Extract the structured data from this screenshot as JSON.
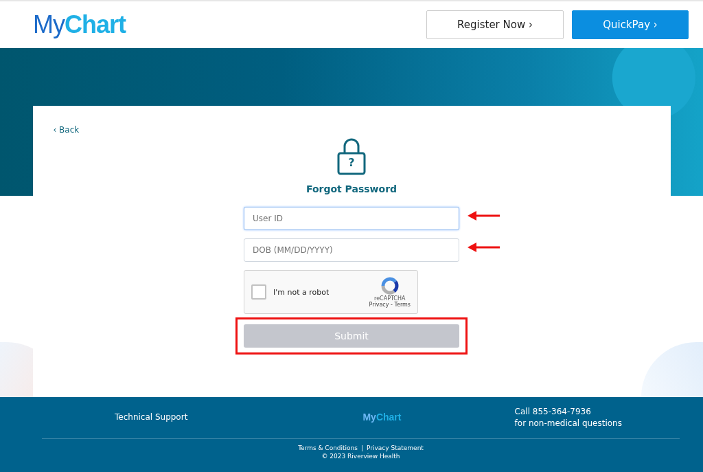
{
  "header": {
    "logo": "My**Chart**",
    "buttons": [
      {
        "label": "Register Now",
        "kind": "outline",
        "chevron": "›"
      },
      {
        "label": "QuickPay",
        "kind": "primary",
        "chevron": "›"
      }
    ]
  },
  "card": {
    "back": {
      "chevron": "‹",
      "label": "Back"
    },
    "lock_mark": "?",
    "title": "Forgot Password",
    "fields": [
      {
        "placeholder": "User ID",
        "focused": true,
        "annotated": true
      },
      {
        "placeholder": "DOB (MM/DD/YYYY)",
        "focused": false,
        "annotated": true
      }
    ],
    "captcha": {
      "label": "I'm not a robot",
      "checked": false,
      "brand": "reCAPTCHA",
      "links": "Privacy - Terms"
    },
    "submit": {
      "label": "Submit",
      "disabled": true,
      "highlighted": true
    }
  },
  "footer": {
    "support": "Technical Support",
    "logo": "My**Chart**",
    "call": "Call 855-364-7936",
    "call_note": "for non-medical questions",
    "links": [
      "Terms & Conditions",
      "Privacy Statement"
    ],
    "separator": "|",
    "copyright": "© 2023 Riverview Health"
  }
}
